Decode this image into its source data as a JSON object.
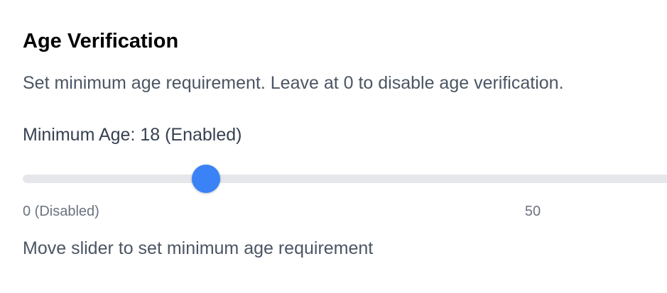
{
  "section": {
    "title": "Age Verification",
    "description": "Set minimum age requirement. Leave at 0 to disable age verification."
  },
  "slider": {
    "label": "Minimum Age: 18 (Enabled)",
    "value": 18,
    "min_label": "0 (Disabled)",
    "mid_label": "50",
    "hint": "Move slider to set minimum age requirement"
  },
  "colors": {
    "accent": "#3b82f6",
    "track": "#e5e7eb",
    "text_muted": "#6b7280"
  }
}
